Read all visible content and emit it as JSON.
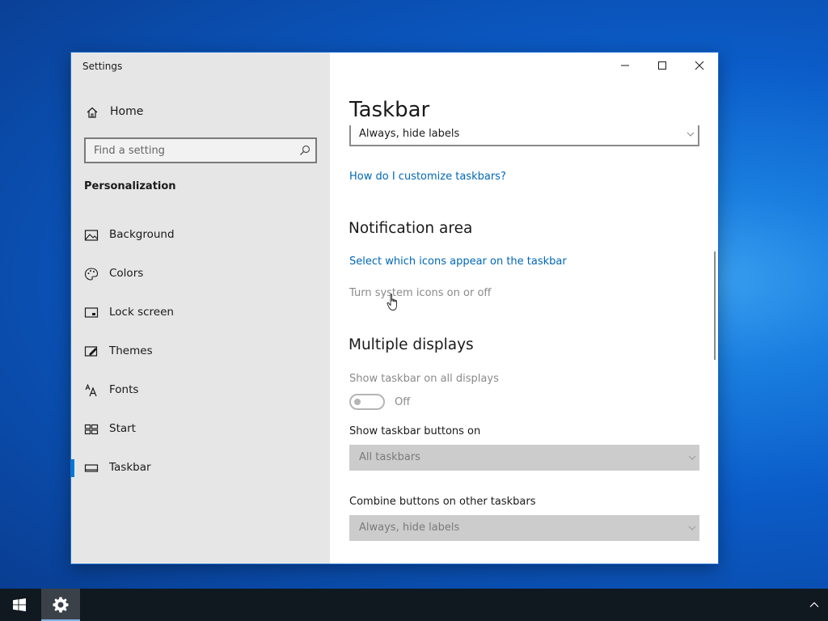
{
  "window": {
    "app_title": "Settings"
  },
  "sidebar": {
    "home_label": "Home",
    "search_placeholder": "Find a setting",
    "section_title": "Personalization",
    "items": [
      {
        "label": "Background",
        "icon": "image-icon"
      },
      {
        "label": "Colors",
        "icon": "palette-icon"
      },
      {
        "label": "Lock screen",
        "icon": "lock-screen-icon"
      },
      {
        "label": "Themes",
        "icon": "brush-icon"
      },
      {
        "label": "Fonts",
        "icon": "fonts-icon"
      },
      {
        "label": "Start",
        "icon": "start-icon"
      },
      {
        "label": "Taskbar",
        "icon": "taskbar-icon",
        "active": true
      }
    ]
  },
  "content": {
    "title": "Taskbar",
    "top_dropdown_value": "Always, hide labels",
    "customize_link": "How do I customize taskbars?",
    "notification_heading": "Notification area",
    "select_icons_link": "Select which icons appear on the taskbar",
    "system_icons_text": "Turn system icons on or off",
    "multiple_displays_heading": "Multiple displays",
    "show_all_displays_label": "Show taskbar on all displays",
    "toggle_state": "Off",
    "buttons_on_label": "Show taskbar buttons on",
    "buttons_on_value": "All taskbars",
    "combine_label": "Combine buttons on other taskbars",
    "combine_value": "Always, hide labels"
  },
  "colors": {
    "accent": "#0078d7",
    "link": "#0067b8",
    "sidebar_bg": "#e6e6e6",
    "taskbar_bg": "#101820"
  },
  "taskbar": {
    "icons": [
      "windows-start-icon",
      "settings-gear-icon",
      "tray-chevron-up-icon"
    ]
  }
}
